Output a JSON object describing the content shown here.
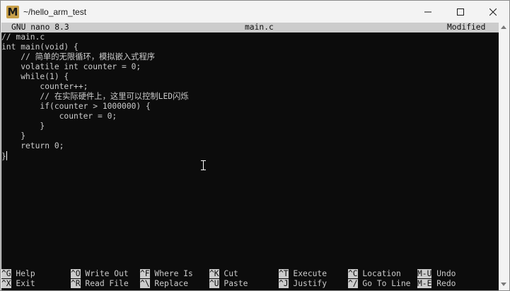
{
  "window": {
    "title": "~/hello_arm_test",
    "app_icon_letter": "M",
    "controls": [
      "minimize-icon",
      "maximize-icon",
      "close-icon"
    ]
  },
  "nano": {
    "version": "GNU nano 8.3",
    "filename": "main.c",
    "status": "Modified"
  },
  "editor": {
    "lines": [
      "// main.c",
      "int main(void) {",
      "    // 简单的无限循环，模拟嵌入式程序",
      "    volatile int counter = 0;",
      "    while(1) {",
      "        counter++;",
      "        // 在实际硬件上，这里可以控制LED闪烁",
      "        if(counter > 1000000) {",
      "            counter = 0;",
      "        }",
      "    }",
      "    return 0;",
      "}"
    ]
  },
  "shortcuts": [
    [
      {
        "key": "^G",
        "label": "Help"
      },
      {
        "key": "^X",
        "label": "Exit"
      }
    ],
    [
      {
        "key": "^O",
        "label": "Write Out"
      },
      {
        "key": "^R",
        "label": "Read File"
      }
    ],
    [
      {
        "key": "^F",
        "label": "Where Is"
      },
      {
        "key": "^\\",
        "label": "Replace"
      }
    ],
    [
      {
        "key": "^K",
        "label": "Cut"
      },
      {
        "key": "^U",
        "label": "Paste"
      }
    ],
    [
      {
        "key": "^T",
        "label": "Execute"
      },
      {
        "key": "^J",
        "label": "Justify"
      }
    ],
    [
      {
        "key": "^C",
        "label": "Location"
      },
      {
        "key": "^/",
        "label": "Go To Line"
      }
    ],
    [
      {
        "key": "M-U",
        "label": "Undo"
      },
      {
        "key": "M-E",
        "label": "Redo"
      }
    ]
  ]
}
